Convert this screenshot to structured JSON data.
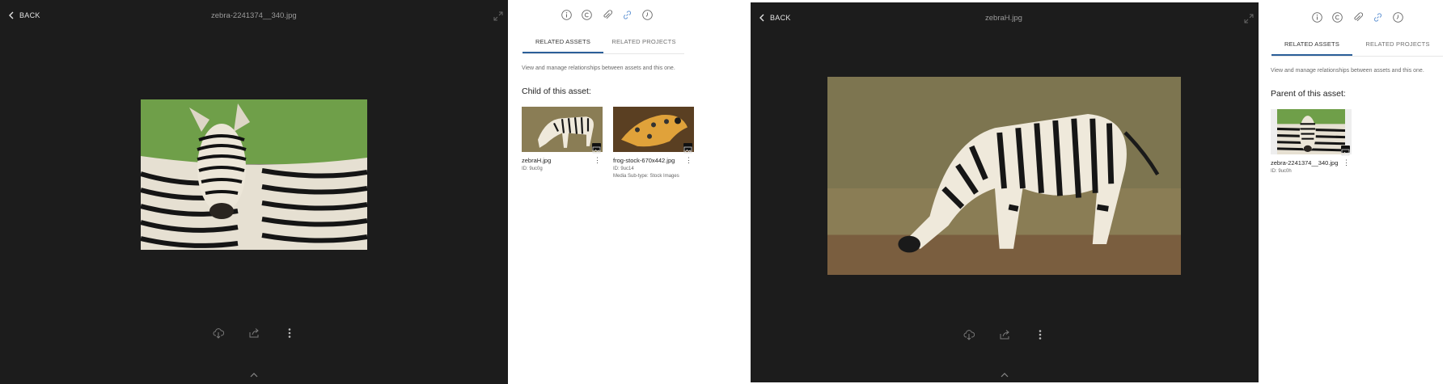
{
  "left": {
    "viewer": {
      "back_label": "BACK",
      "filename": "zebra-2241374__340.jpg"
    },
    "panel": {
      "tab_related_assets": "RELATED ASSETS",
      "tab_related_projects": "RELATED PROJECTS",
      "description": "View and manage relationships between assets and this one.",
      "section_title": "Child of this asset:",
      "cards": [
        {
          "name": "zebraH.jpg",
          "id": "ID: 9uc0g",
          "extra": ""
        },
        {
          "name": "frog-stock-670x442.jpg",
          "id": "ID: 9uc14",
          "extra": "Media Sub-type: Stock Images"
        }
      ]
    }
  },
  "right": {
    "viewer": {
      "back_label": "BACK",
      "filename": "zebraH.jpg"
    },
    "panel": {
      "tab_related_assets": "RELATED ASSETS",
      "tab_related_projects": "RELATED PROJECTS",
      "description": "View and manage relationships between assets and this one.",
      "section_title": "Parent of this asset:",
      "cards": [
        {
          "name": "zebra-2241374__340.jpg",
          "id": "ID: 9uc0h"
        }
      ]
    }
  },
  "icons": [
    "info-icon",
    "copyright-icon",
    "attachment-icon",
    "link-icon",
    "history-icon",
    "cloud-download-icon",
    "share-icon",
    "more-vertical-icon",
    "expand-icon",
    "chevron-up-icon",
    "image-type-icon"
  ],
  "colors": {
    "viewer_bg": "#1c1c1c",
    "active_tab": "#2b5f99"
  }
}
